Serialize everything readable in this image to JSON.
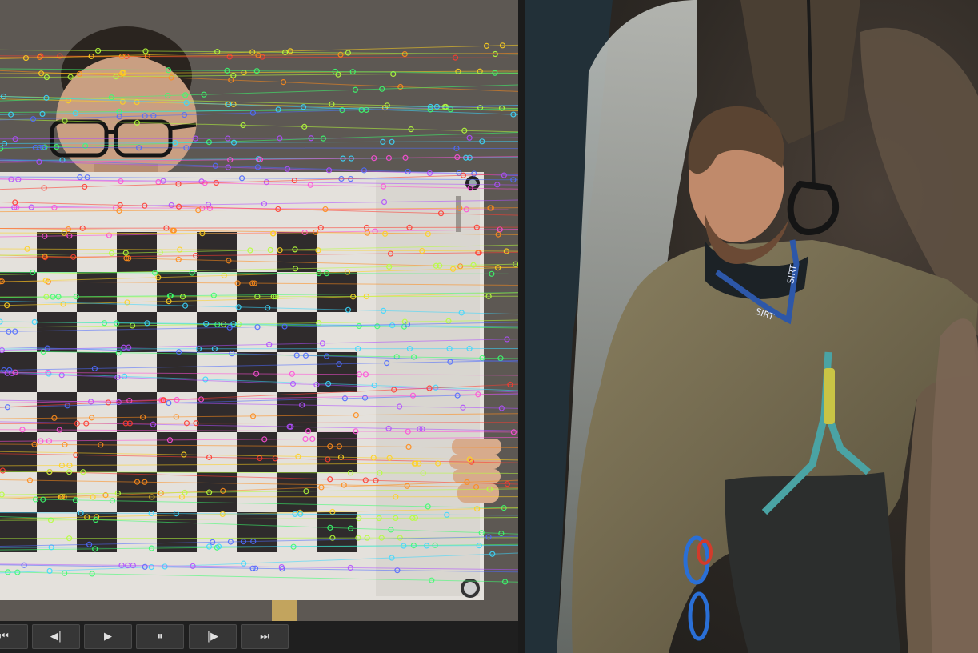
{
  "transport": {
    "buttons": [
      {
        "name": "skip-to-start-button",
        "icon": "skip-back-icon",
        "glyph": "⏮"
      },
      {
        "name": "step-back-button",
        "icon": "step-back-icon",
        "glyph": "◀|"
      },
      {
        "name": "play-button",
        "icon": "play-icon",
        "glyph": "▶"
      },
      {
        "name": "pause-button",
        "icon": "pause-icon",
        "glyph": "⏸"
      },
      {
        "name": "step-forward-button",
        "icon": "step-forward-icon",
        "glyph": "|▶"
      },
      {
        "name": "skip-to-end-button",
        "icon": "fast-forward-icon",
        "glyph": "⏭"
      }
    ]
  },
  "overlay": {
    "track_colors": [
      "#ff3b30",
      "#ff8c1a",
      "#ffd21f",
      "#b6ff3b",
      "#3bff6e",
      "#3bd8ff",
      "#4f6bff",
      "#b04fff",
      "#ff4fd8"
    ],
    "checkerboard": {
      "rows": 8,
      "cols": 9
    }
  },
  "right_view": {
    "lanyard_text": [
      "SIRT",
      "SIRT"
    ]
  }
}
